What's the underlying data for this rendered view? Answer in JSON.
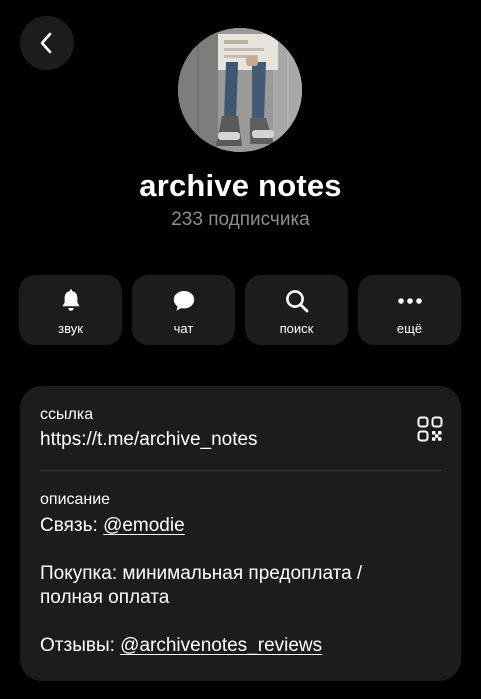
{
  "header": {
    "back_icon": "chevron-left-icon"
  },
  "channel": {
    "title": "archive notes",
    "subscribers": "233 подписчика"
  },
  "actions": [
    {
      "label": "звук",
      "icon": "bell-icon"
    },
    {
      "label": "чат",
      "icon": "chat-bubble-icon"
    },
    {
      "label": "поиск",
      "icon": "search-icon"
    },
    {
      "label": "ещё",
      "icon": "more-dots-icon"
    }
  ],
  "info": {
    "link_label": "ссылка",
    "link_value": "https://t.me/archive_notes",
    "qr_icon": "qr-code-icon",
    "description_label": "описание",
    "contact_prefix": "Связь: ",
    "contact_handle": "@emodie",
    "purchase_line1": "Покупка: минимальная предоплата /",
    "purchase_line2": "полная оплата",
    "reviews_prefix": "Отзывы: ",
    "reviews_handle": "@archivenotes_reviews"
  },
  "colors": {
    "background": "#000000",
    "surface": "#1c1c1e",
    "secondary_text": "#8d8d93",
    "divider": "#38383a"
  }
}
